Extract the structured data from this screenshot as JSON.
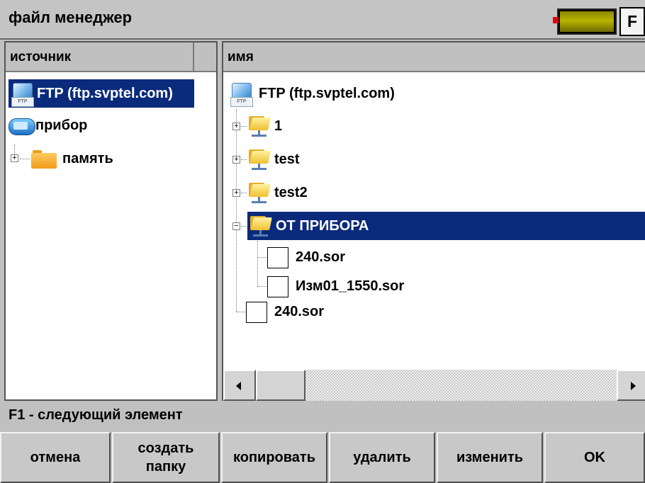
{
  "title_bar": {
    "title": "файл менеджер",
    "f_key": "F"
  },
  "source_panel": {
    "header": "источник",
    "items": [
      {
        "label": "FTP (ftp.svptel.com)",
        "icon": "ftp-icon",
        "selected": true
      },
      {
        "label": "прибор",
        "icon": "device-icon",
        "selected": false
      },
      {
        "label": "память",
        "icon": "folder-icon",
        "selected": false
      }
    ]
  },
  "name_panel": {
    "header": "имя",
    "root": {
      "label": "FTP (ftp.svptel.com)",
      "icon": "ftp-icon"
    },
    "items": [
      {
        "label": "1",
        "icon": "network-folder-icon"
      },
      {
        "label": "test",
        "icon": "network-folder-icon"
      },
      {
        "label": "test2",
        "icon": "network-folder-icon"
      },
      {
        "label": "ОТ ПРИБОРА",
        "icon": "network-folder-icon",
        "selected": true
      },
      {
        "label": "240.sor",
        "icon": "file-icon"
      },
      {
        "label": "Изм01_1550.sor",
        "icon": "file-icon"
      },
      {
        "label": "240.sor",
        "icon": "file-icon"
      }
    ]
  },
  "status": {
    "text": "F1 - следующий элемент"
  },
  "buttons": {
    "cancel": "отмена",
    "create_folder_line1": "создать",
    "create_folder_line2": "папку",
    "copy": "копировать",
    "delete": "удалить",
    "edit": "изменить",
    "ok": "OK"
  },
  "colors": {
    "selection": "#0a2a7c",
    "background": "#c0c0c0",
    "battery": "#b8b400"
  }
}
